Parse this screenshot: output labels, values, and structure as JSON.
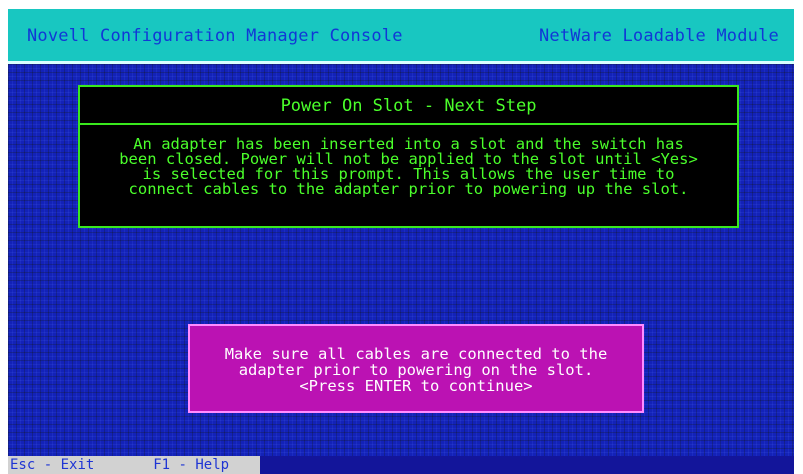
{
  "header": {
    "title": "Novell Configuration Manager Console",
    "subtitle": "NetWare Loadable Module"
  },
  "dialog": {
    "title": "Power On Slot - Next Step",
    "lines": [
      "An adapter has been inserted into a slot and the switch has",
      "been closed. Power will not be applied to the slot until <Yes>",
      "is selected for this prompt. This allows the user time to",
      "connect cables to the adapter prior to powering up the slot."
    ]
  },
  "alert": {
    "lines": [
      "Make sure all cables are connected to the",
      "adapter prior to powering on the slot.",
      "<Press ENTER to continue>"
    ]
  },
  "status_bar": {
    "keys": [
      {
        "key": "Esc",
        "label": "Exit"
      },
      {
        "key": "F1",
        "label": "Help"
      }
    ]
  },
  "colors": {
    "header_bg": "#18c7c1",
    "header_text": "#1137d6",
    "console_bg": "#1322b8",
    "dialog_bg": "#000000",
    "dialog_text": "#4bff2b",
    "alert_bg": "#bb12b3",
    "alert_text": "#ffffff",
    "status_bg": "#d2d2d2"
  }
}
